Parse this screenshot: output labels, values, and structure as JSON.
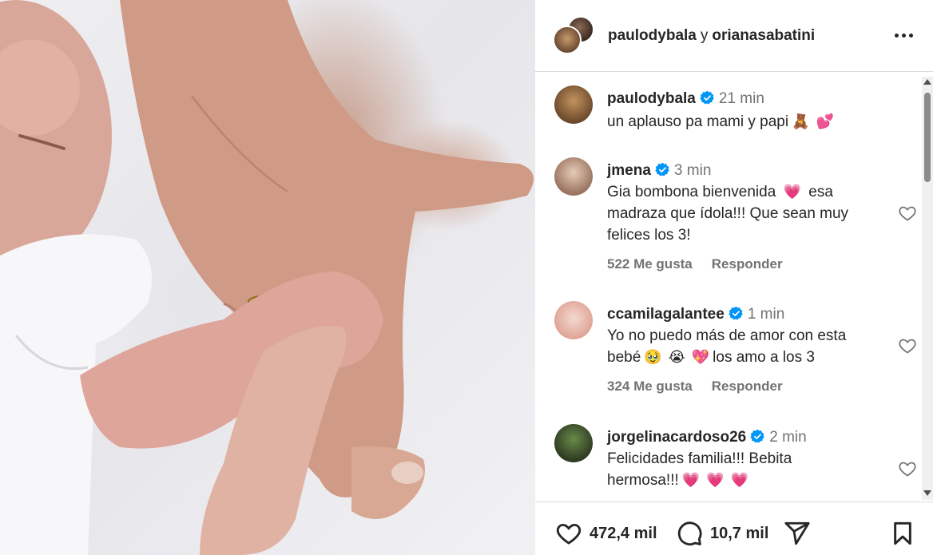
{
  "post": {
    "authors": [
      "paulodybala",
      "orianasabatini"
    ],
    "joiner": "y"
  },
  "caption": {
    "username": "paulodybala",
    "time": "21 min",
    "text": "un aplauso pa mami y papi",
    "emojis": [
      "🧸",
      "💕"
    ]
  },
  "comments": [
    {
      "username": "jmena",
      "time": "3 min",
      "lines": [
        "Gia bombona bienvenida ",
        " esa",
        "madraza que ídola!!! Que sean muy",
        "felices los 3!"
      ],
      "emoji": "💗",
      "likes": "522 Me gusta",
      "reply": "Responder"
    },
    {
      "username": "ccamilagalantee",
      "time": "1 min",
      "line1": "Yo no puedo más de amor con esta",
      "line2_start": "bebé",
      "line2_end": "los amo a los 3",
      "emojis": [
        "🥹",
        "😭",
        "💖"
      ],
      "likes": "324 Me gusta",
      "reply": "Responder"
    },
    {
      "username": "jorgelinacardoso26",
      "time": "2 min",
      "line1": "Felicidades familia!!! Bebita",
      "line2": "hermosa!!!",
      "emojis": [
        "💗",
        "💗",
        "💗"
      ]
    }
  ],
  "actions": {
    "likes": "472,4 mil",
    "comments": "10,7 mil"
  },
  "colors": {
    "verified": "#0095f6",
    "text": "#262626",
    "muted": "#737373",
    "heart_emoji": "#ee2a5f"
  },
  "icons": [
    "more-icon",
    "verified-icon",
    "heart-icon",
    "comment-icon",
    "share-icon",
    "bookmark-icon"
  ]
}
